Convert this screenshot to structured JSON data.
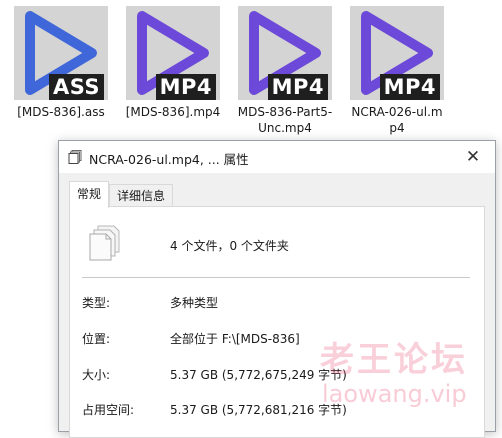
{
  "files": [
    {
      "name": "[MDS-836].ass",
      "badge": "ASS",
      "play_color": "#3f67d9"
    },
    {
      "name": "[MDS-836].mp4",
      "badge": "MP4",
      "play_color": "#6c49d8"
    },
    {
      "name": "MDS-836-Part5-Unc.mp4",
      "badge": "MP4",
      "play_color": "#6c49d8"
    },
    {
      "name": "NCRA-026-ul.mp4",
      "badge": "MP4",
      "play_color": "#6c49d8"
    }
  ],
  "dialog": {
    "title": "NCRA-026-ul.mp4, ... 属性",
    "close_glyph": "✕",
    "tabs": [
      {
        "label": "常规",
        "active": true
      },
      {
        "label": "详细信息",
        "active": false
      }
    ],
    "summary": "4 个文件，0 个文件夹",
    "rows": [
      {
        "label": "类型:",
        "value": "多种类型"
      },
      {
        "label": "位置:",
        "value": "全部位于 F:\\[MDS-836]"
      },
      {
        "label": "大小:",
        "value": "5.37 GB (5,772,675,249 字节)"
      },
      {
        "label": "占用空间:",
        "value": "5.37 GB (5,772,681,216 字节)"
      }
    ]
  },
  "watermark": {
    "line1": "老王论坛",
    "line2": "laowang.vip"
  }
}
